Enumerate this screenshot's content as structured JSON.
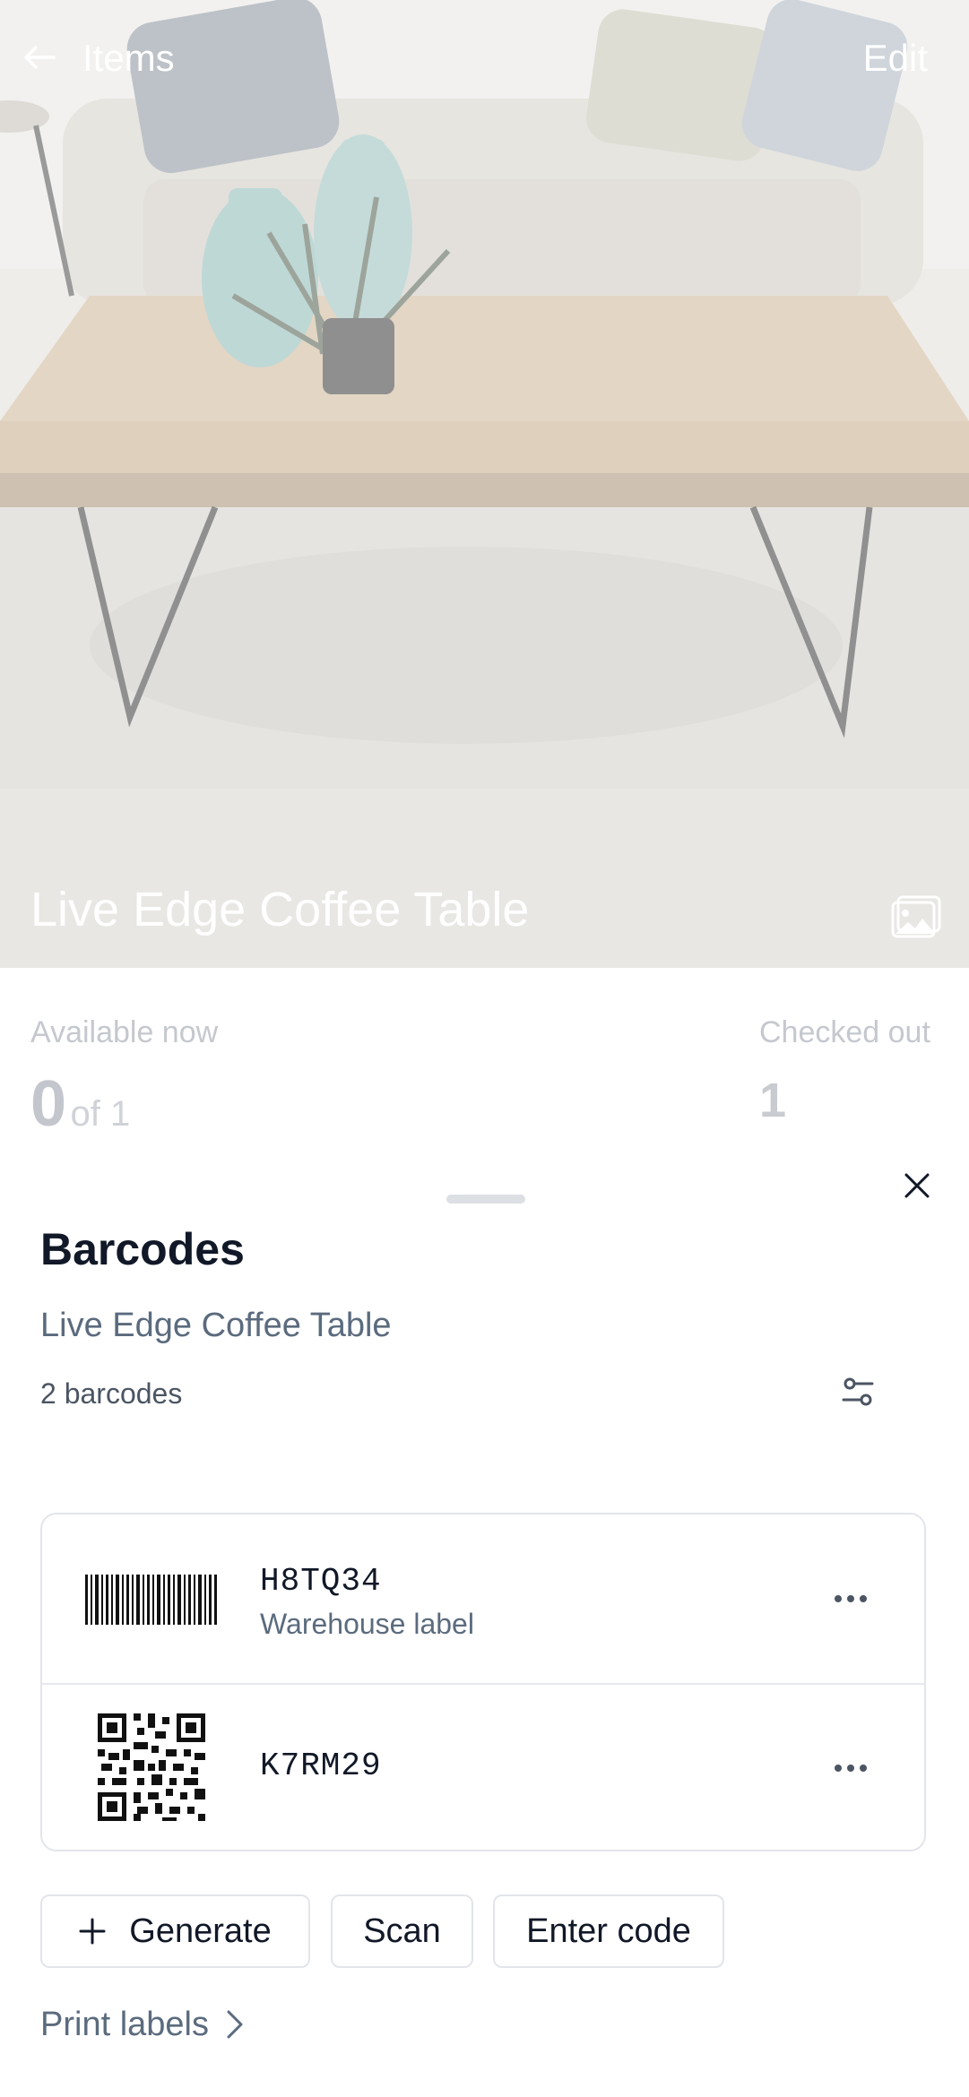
{
  "header": {
    "back_label": "Items",
    "edit_label": "Edit"
  },
  "item": {
    "title": "Live Edge Coffee Table"
  },
  "stats": {
    "available_label": "Available now",
    "available_value": "0",
    "available_total": "of 1",
    "checked_out_label": "Checked out",
    "checked_out_value": "1"
  },
  "sheet": {
    "title": "Barcodes",
    "subtitle": "Live Edge Coffee Table",
    "count": "2 barcodes",
    "barcodes": [
      {
        "code": "H8TQ34",
        "label": "Warehouse label",
        "kind": "barcode-icon"
      },
      {
        "code": "K7RM29",
        "label": "",
        "kind": "qr-code-icon"
      }
    ],
    "actions": {
      "generate": "Generate",
      "scan": "Scan",
      "enter_code": "Enter code"
    },
    "print_labels": "Print labels"
  }
}
